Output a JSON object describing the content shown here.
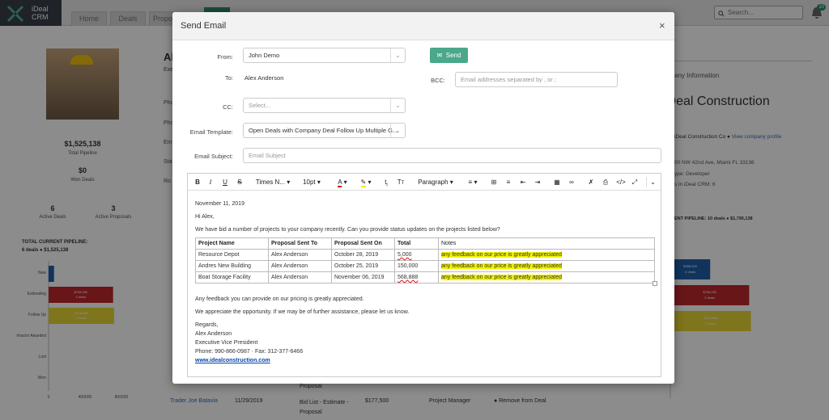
{
  "app": {
    "logo_line1": "iDeal",
    "logo_line2": "CRM",
    "nav": [
      "Home",
      "Deals",
      "Propo"
    ],
    "search_placeholder": "Search...",
    "notif_count": "10"
  },
  "background": {
    "profile": {
      "pipeline_value": "$1,525,138",
      "pipeline_label": "Total Pipeline",
      "won_value": "$0",
      "won_label": "Won Deals",
      "active_deals_value": "6",
      "active_deals_label": "Active Deals",
      "active_proposals_value": "3",
      "active_proposals_label": "Active Proposals"
    },
    "heading": "Al",
    "sub": "Exe",
    "labels_left": [
      "Pho",
      "Pho",
      "Em",
      "Sta",
      "Ro"
    ],
    "pipeline_title": "TOTAL CURRENT PIPELINE:",
    "pipeline_sub": "6 deals ● $1,525,138",
    "stages": [
      "New",
      "Estimating",
      "Follow Up",
      "Contractor Awarded",
      "Lost",
      "Won"
    ],
    "xticks": [
      "0",
      "400000",
      "800000"
    ],
    "bars": [
      {
        "stage": "New",
        "value": "",
        "deals": "",
        "color": "#1f5fa8",
        "v": 60000
      },
      {
        "stage": "Estimating",
        "value": "$708,250",
        "deals": "3 deals",
        "color": "#c0282d",
        "v": 708250
      },
      {
        "stage": "Follow Up",
        "value": "$718,888",
        "deals": "2 deals",
        "color": "#e7d635",
        "v": 718888
      }
    ],
    "company": {
      "section": "any Information",
      "name": "iDeal Construction",
      "line1": "iDeal Construction Co ●",
      "link": "View company profile",
      "addr": "00 NW 42nd Ave, Miami FL 33136",
      "type": "ype: Developer",
      "crm": "s in iDeal CRM: 6",
      "pipe": "ENT PIPELINE: 10 deals ● $1,790,138"
    },
    "right_bars": [
      {
        "value": "$358,000",
        "deals": "4 deals",
        "color": "#1f5fa8",
        "v": 358000
      },
      {
        "value": "$708,250",
        "deals": "3 deals",
        "color": "#c0282d",
        "v": 708250
      },
      {
        "value": "$723,888",
        "deals": "3 deals",
        "color": "#e7d635",
        "v": 723888
      }
    ],
    "row": {
      "name": "Trader Joe Batavia",
      "date": "11/29/2019",
      "stage": "Bid List - Estimate - Proposal",
      "amount": "$177,500",
      "role": "Project Manager",
      "action": "Remove from Deal",
      "prev_stage": "Proposal"
    }
  },
  "modal": {
    "title": "Send Email",
    "close": "×",
    "from_label": "From:",
    "from_value": "John Demo",
    "to_label": "To:",
    "to_value": "Alex Anderson",
    "bcc_label": "BCC:",
    "bcc_placeholder": "Email addresses separated by , or ;",
    "cc_label": "CC:",
    "cc_placeholder": "Select...",
    "template_label": "Email Template:",
    "template_value": "Open Deals with Company Deal Follow Up Multiple G...",
    "subject_label": "Email Subject:",
    "subject_placeholder": "Email Subject",
    "send_label": "Send",
    "toolbar": {
      "font": "Times N...",
      "size": "10pt",
      "paragraph": "Paragraph"
    },
    "email": {
      "date": "November 11, 2019",
      "greeting": "Hi Alex,",
      "intro": "We have bid a number of projects to your company recently. Can you provide status updates on the projects listed below?",
      "columns": [
        "Project Name",
        "Proposal Sent To",
        "Proposal Sent On",
        "Total",
        "Notes"
      ],
      "rows": [
        [
          "Resource Depot",
          "Alex Anderson",
          "October 28, 2019",
          "5,000",
          "any feedback on our price is greatly appreciated"
        ],
        [
          "Andres New Building",
          "Alex Anderson",
          "October 25, 2019",
          "150,000",
          "any feedback on our price is greatly appreciated"
        ],
        [
          "Boat Storage Facility",
          "Alex Anderson",
          "November 06, 2019",
          "568,888",
          "any feedback on our price is greatly appreciated"
        ]
      ],
      "p1": "Any feedback you can provide on our pricing is greatly appreciated.",
      "p2": "We appreciate the opportunity. If we may be of further assistance, please let us know.",
      "regards": "Regards,",
      "sig_name": "Alex Anderson",
      "sig_title": "Executive Vice President",
      "sig_phone": "Phone: 990-866-0987 · Fax: 312-377-6466",
      "sig_url": "www.idealconstruction.com"
    }
  }
}
